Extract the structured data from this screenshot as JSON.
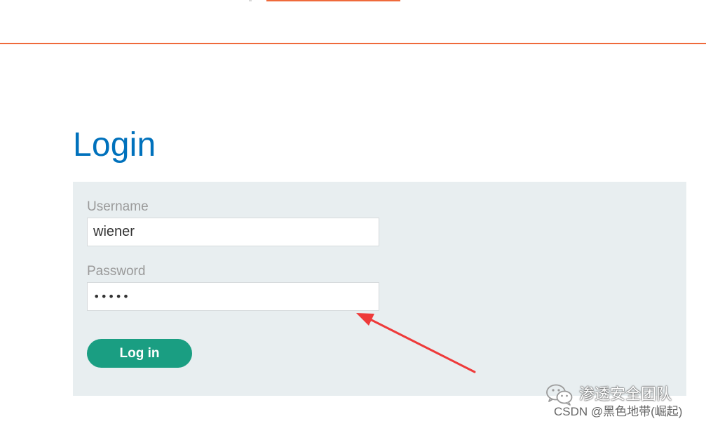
{
  "page": {
    "title": "Login"
  },
  "form": {
    "username_label": "Username",
    "username_value": "wiener",
    "password_label": "Password",
    "password_value": "•••••",
    "submit_label": "Log in"
  },
  "annotation": {
    "arrow_color": "#ee3a3a",
    "arrow_target": "password-input"
  },
  "watermark": {
    "icon": "wechat-icon",
    "team_name": "渗透安全团队",
    "source": "CSDN @黑色地带(崛起)"
  },
  "colors": {
    "accent_orange": "#ef6a3b",
    "title_blue": "#0071bc",
    "button_green": "#1a9e82",
    "panel_background": "#e8eef0"
  }
}
